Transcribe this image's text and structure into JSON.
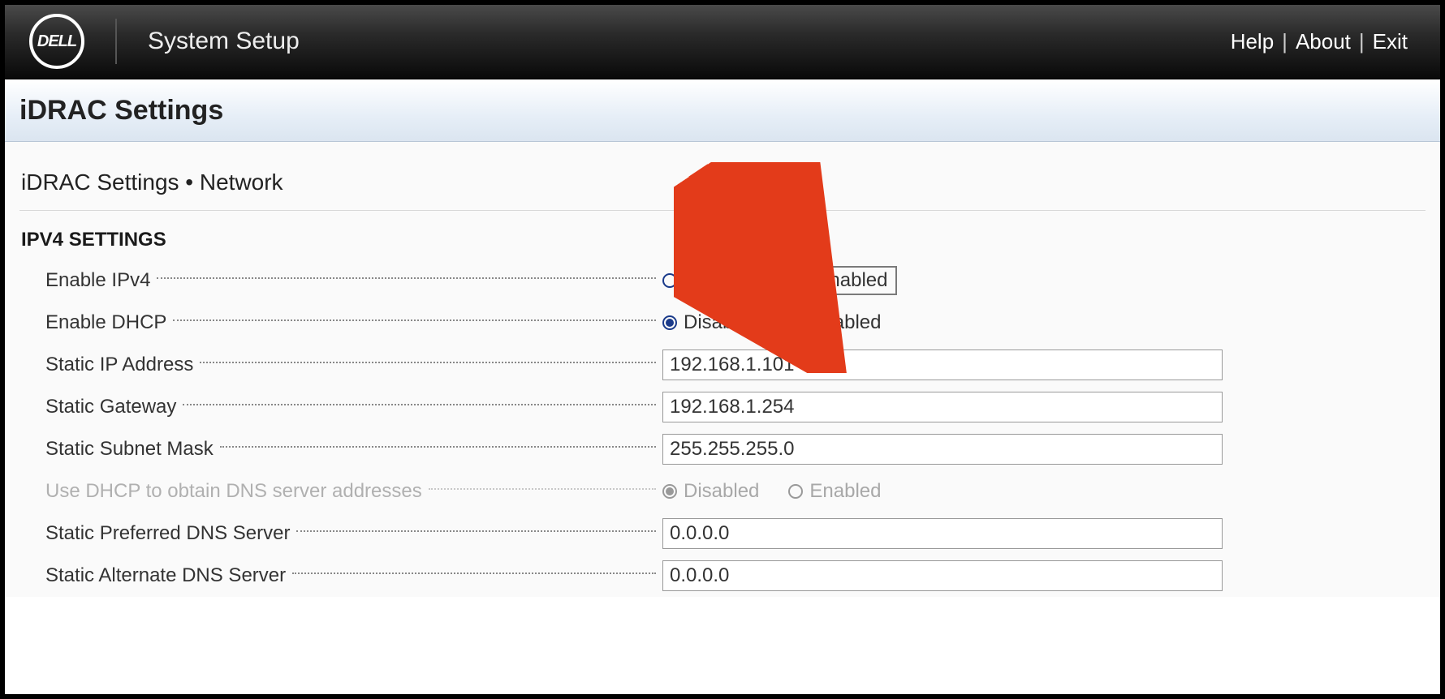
{
  "header": {
    "logo_text": "DELL",
    "app_title": "System Setup",
    "links": {
      "help": "Help",
      "about": "About",
      "exit": "Exit"
    }
  },
  "titlebar": {
    "page_title": "iDRAC Settings"
  },
  "breadcrumb": "iDRAC Settings • Network",
  "section": {
    "title": "IPV4 SETTINGS"
  },
  "options": {
    "disabled": "Disabled",
    "enabled": "Enabled"
  },
  "fields": {
    "enable_ipv4": {
      "label": "Enable IPv4",
      "value": "Enabled"
    },
    "enable_dhcp": {
      "label": "Enable DHCP",
      "value": "Disabled"
    },
    "static_ip": {
      "label": "Static IP Address",
      "value": "192.168.1.101"
    },
    "static_gateway": {
      "label": "Static Gateway",
      "value": "192.168.1.254"
    },
    "static_subnet": {
      "label": "Static Subnet Mask",
      "value": "255.255.255.0"
    },
    "dhcp_dns": {
      "label": "Use DHCP to obtain DNS server addresses",
      "value": "Disabled"
    },
    "preferred_dns": {
      "label": "Static Preferred DNS Server",
      "value": "0.0.0.0"
    },
    "alternate_dns": {
      "label": "Static Alternate DNS Server",
      "value": "0.0.0.0"
    }
  },
  "annotation": {
    "arrow_color": "#e33b1a"
  }
}
